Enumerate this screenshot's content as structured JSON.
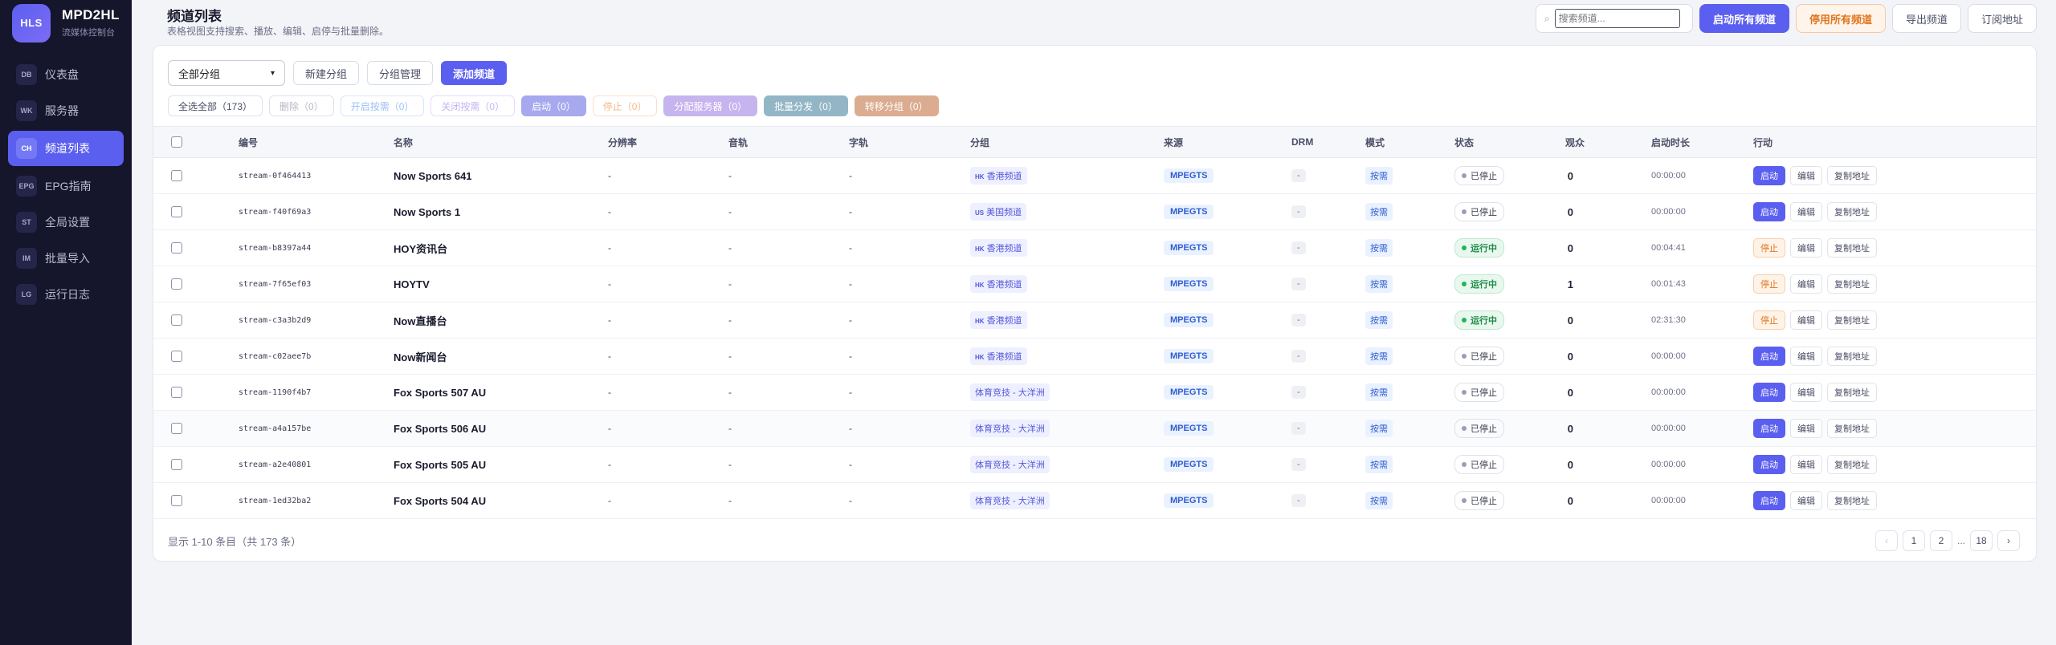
{
  "brand": {
    "logo": "HLS",
    "name": "MPD2HL",
    "subtitle": "流媒体控制台"
  },
  "sidebar": {
    "items": [
      {
        "code": "DB",
        "label": "仪表盘",
        "active": false
      },
      {
        "code": "WK",
        "label": "服务器",
        "active": false
      },
      {
        "code": "CH",
        "label": "频道列表",
        "active": true
      },
      {
        "code": "EPG",
        "label": "EPG指南",
        "active": false
      },
      {
        "code": "ST",
        "label": "全局设置",
        "active": false
      },
      {
        "code": "IM",
        "label": "批量导入",
        "active": false
      },
      {
        "code": "LG",
        "label": "运行日志",
        "active": false
      }
    ]
  },
  "header": {
    "title": "频道列表",
    "subtitle": "表格视图支持搜索、播放、编辑、启停与批量删除。",
    "search_placeholder": "搜索频道...",
    "search_icon": "⌕",
    "start_all": "启动所有频道",
    "stop_all": "停用所有频道",
    "export": "导出频道",
    "subscribe": "订阅地址"
  },
  "toolbar": {
    "group_select": "全部分组",
    "new_group": "新建分组",
    "manage_group": "分组管理",
    "add_channel": "添加频道",
    "select_all": "全选全部（173）",
    "delete": "删除（0）",
    "enable_ondemand": "开启按需（0）",
    "disable_ondemand": "关闭按需（0）",
    "start": "启动（0）",
    "stop": "停止（0）",
    "assign_server": "分配服务器（0）",
    "batch_dispatch": "批量分发（0）",
    "move_group": "转移分组（0）"
  },
  "table": {
    "headers": {
      "id": "编号",
      "name": "名称",
      "resolution": "分辨率",
      "audio": "音轨",
      "subtitle": "字轨",
      "group": "分组",
      "source": "来源",
      "drm": "DRM",
      "mode": "模式",
      "status": "状态",
      "viewers": "观众",
      "uptime": "启动时长",
      "actions": "行动"
    },
    "action_labels": {
      "start": "启动",
      "stop": "停止",
      "edit": "编辑",
      "copy": "复制地址"
    },
    "rows": [
      {
        "id": "stream-0f464413",
        "name": "Now Sports 641",
        "res": "-",
        "audio": "-",
        "sub": "-",
        "group_code": "HK",
        "group": "香港频道",
        "source": "MPEGTS",
        "drm": "-",
        "mode": "按需",
        "status": "已停止",
        "running": false,
        "viewers": "0",
        "uptime": "00:00:00"
      },
      {
        "id": "stream-f40f69a3",
        "name": "Now Sports 1",
        "res": "-",
        "audio": "-",
        "sub": "-",
        "group_code": "US",
        "group": "美国频道",
        "source": "MPEGTS",
        "drm": "-",
        "mode": "按需",
        "status": "已停止",
        "running": false,
        "viewers": "0",
        "uptime": "00:00:00"
      },
      {
        "id": "stream-b8397a44",
        "name": "HOY资讯台",
        "res": "-",
        "audio": "-",
        "sub": "-",
        "group_code": "HK",
        "group": "香港频道",
        "source": "MPEGTS",
        "drm": "-",
        "mode": "按需",
        "status": "运行中",
        "running": true,
        "viewers": "0",
        "uptime": "00:04:41"
      },
      {
        "id": "stream-7f65ef03",
        "name": "HOYTV",
        "res": "-",
        "audio": "-",
        "sub": "-",
        "group_code": "HK",
        "group": "香港频道",
        "source": "MPEGTS",
        "drm": "-",
        "mode": "按需",
        "status": "运行中",
        "running": true,
        "viewers": "1",
        "uptime": "00:01:43"
      },
      {
        "id": "stream-c3a3b2d9",
        "name": "Now直播台",
        "res": "-",
        "audio": "-",
        "sub": "-",
        "group_code": "HK",
        "group": "香港频道",
        "source": "MPEGTS",
        "drm": "-",
        "mode": "按需",
        "status": "运行中",
        "running": true,
        "viewers": "0",
        "uptime": "02:31:30"
      },
      {
        "id": "stream-c02aee7b",
        "name": "Now新闻台",
        "res": "-",
        "audio": "-",
        "sub": "-",
        "group_code": "HK",
        "group": "香港频道",
        "source": "MPEGTS",
        "drm": "-",
        "mode": "按需",
        "status": "已停止",
        "running": false,
        "viewers": "0",
        "uptime": "00:00:00"
      },
      {
        "id": "stream-1190f4b7",
        "name": "Fox Sports 507 AU",
        "res": "-",
        "audio": "-",
        "sub": "-",
        "group_code": "",
        "group": "体育竞技 - 大洋洲",
        "source": "MPEGTS",
        "drm": "-",
        "mode": "按需",
        "status": "已停止",
        "running": false,
        "viewers": "0",
        "uptime": "00:00:00"
      },
      {
        "id": "stream-a4a157be",
        "name": "Fox Sports 506 AU",
        "res": "-",
        "audio": "-",
        "sub": "-",
        "group_code": "",
        "group": "体育竞技 - 大洋洲",
        "source": "MPEGTS",
        "drm": "-",
        "mode": "按需",
        "status": "已停止",
        "running": false,
        "viewers": "0",
        "uptime": "00:00:00"
      },
      {
        "id": "stream-a2e40801",
        "name": "Fox Sports 505 AU",
        "res": "-",
        "audio": "-",
        "sub": "-",
        "group_code": "",
        "group": "体育竞技 - 大洋洲",
        "source": "MPEGTS",
        "drm": "-",
        "mode": "按需",
        "status": "已停止",
        "running": false,
        "viewers": "0",
        "uptime": "00:00:00"
      },
      {
        "id": "stream-1ed32ba2",
        "name": "Fox Sports 504 AU",
        "res": "-",
        "audio": "-",
        "sub": "-",
        "group_code": "",
        "group": "体育竞技 - 大洋洲",
        "source": "MPEGTS",
        "drm": "-",
        "mode": "按需",
        "status": "已停止",
        "running": false,
        "viewers": "0",
        "uptime": "00:00:00"
      }
    ]
  },
  "footer": {
    "info": "显示 1-10 条目（共 173 条）",
    "prev": "‹",
    "pages": [
      "1",
      "2"
    ],
    "ellipsis": "...",
    "last": "18",
    "next": "›"
  },
  "colors": {
    "accent": "#5b5ff0",
    "sidebar": "#15152b",
    "running": "#22b35a",
    "warn": "#e0761f"
  }
}
